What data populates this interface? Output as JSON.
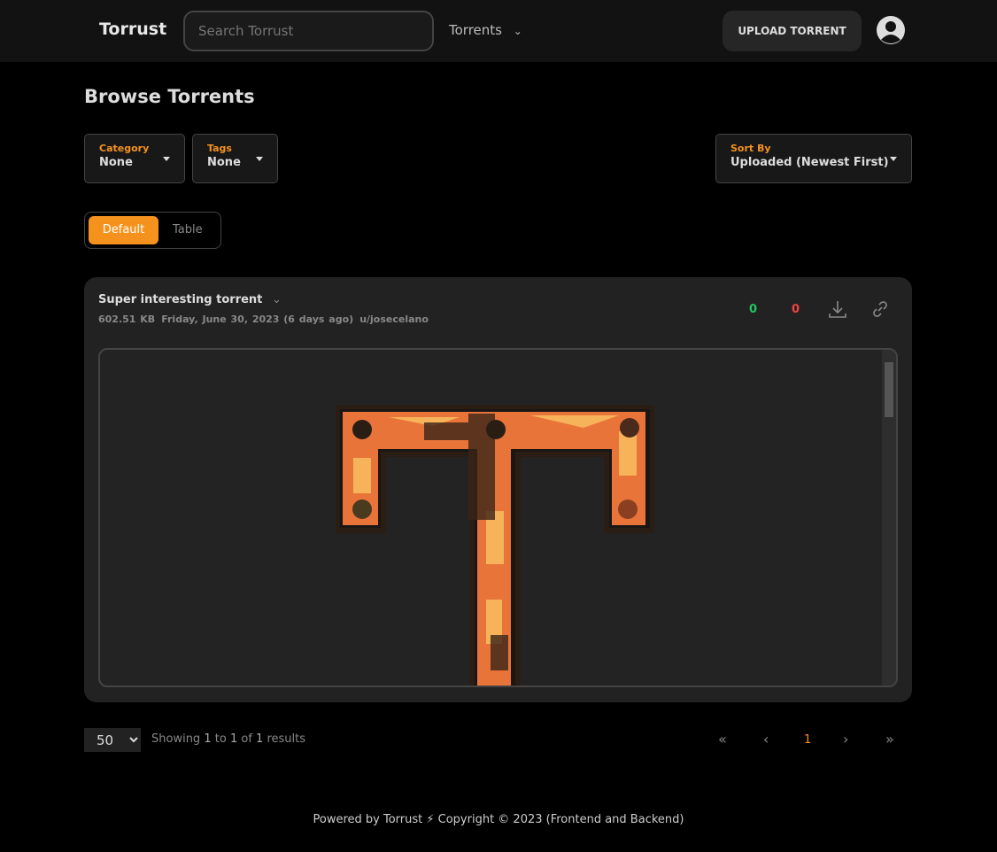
{
  "nav": {
    "brand": "Torrust",
    "search_placeholder": "Search Torrust",
    "torrents_menu": "Torrents",
    "upload": "UPLOAD TORRENT"
  },
  "page": {
    "title": "Browse Torrents"
  },
  "filters": {
    "category_label": "Category",
    "category_value": "None",
    "tags_label": "Tags",
    "tags_value": "None",
    "sort_label": "Sort By",
    "sort_value": "Uploaded (Newest First)"
  },
  "view_toggle": {
    "default": "Default",
    "table": "Table",
    "active": "Default"
  },
  "torrent": {
    "title": "Super interesting torrent",
    "size": "602.51 KB",
    "date": "Friday, June 30, 2023 (6 days ago)",
    "uploader": "u/josecelano",
    "seeders": "0",
    "leechers": "0",
    "seeders_color": "#22c55e",
    "leechers_color": "#ef4444"
  },
  "pagination": {
    "page_size": "50",
    "showing": "Showing",
    "from": "1",
    "to_word": "to",
    "to": "1",
    "of_word": "of",
    "total": "1",
    "results": "results",
    "current_page": "1",
    "first": "«",
    "prev": "‹",
    "next": "›",
    "last": "»"
  },
  "footer": {
    "text": "Powered by Torrust ⚡ Copyright © 2023 (Frontend and Backend)"
  },
  "colors": {
    "accent": "#f5921e"
  }
}
